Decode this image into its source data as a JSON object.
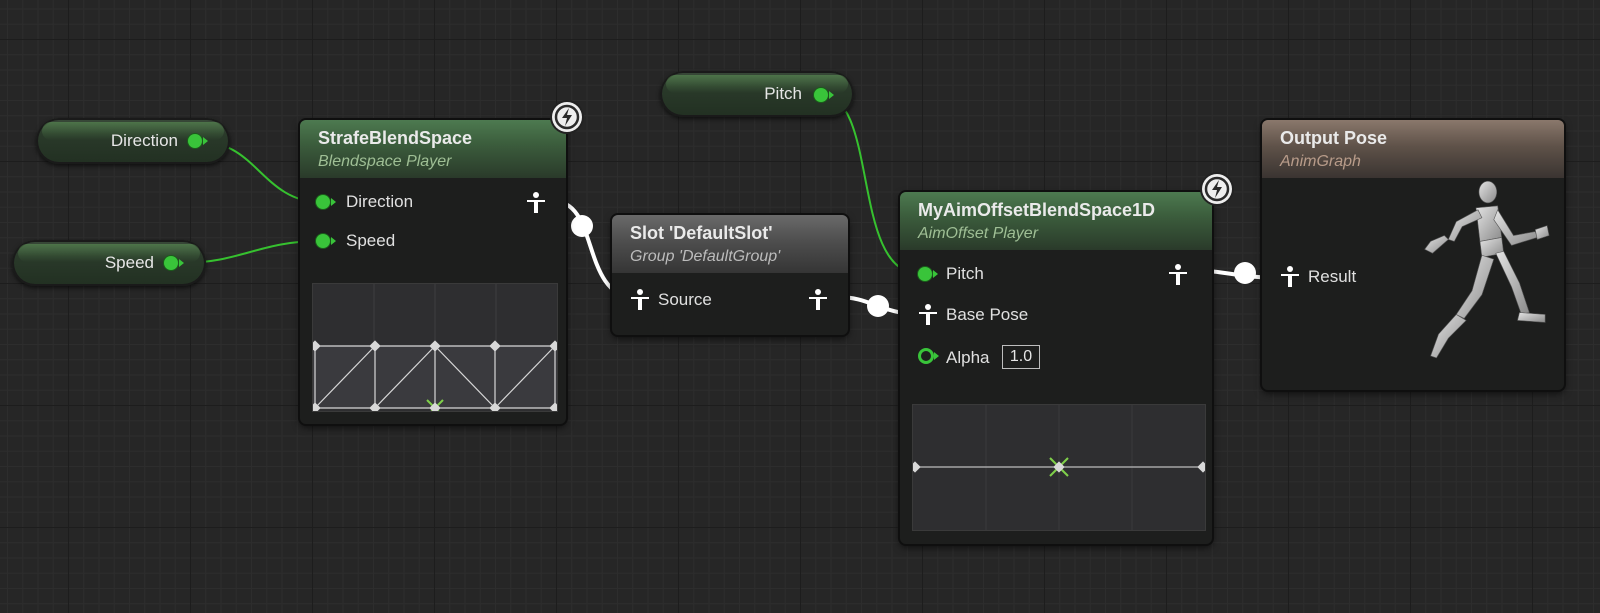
{
  "variables": {
    "direction": {
      "label": "Direction"
    },
    "speed": {
      "label": "Speed"
    },
    "pitch": {
      "label": "Pitch"
    }
  },
  "nodes": {
    "strafe_blend_space": {
      "title": "StrafeBlendSpace",
      "subtitle": "Blendspace Player",
      "pins": {
        "direction": "Direction",
        "speed": "Speed"
      }
    },
    "slot": {
      "title": "Slot 'DefaultSlot'",
      "subtitle": "Group 'DefaultGroup'",
      "pins": {
        "source": "Source"
      }
    },
    "aim_offset": {
      "title": "MyAimOffsetBlendSpace1D",
      "subtitle": "AimOffset Player",
      "pins": {
        "pitch": "Pitch",
        "base_pose": "Base Pose",
        "alpha": "Alpha",
        "alpha_value": "1.0"
      }
    },
    "output_pose": {
      "title": "Output Pose",
      "subtitle": "AnimGraph",
      "pins": {
        "result": "Result"
      }
    }
  },
  "colors": {
    "data_wire": "#36c12f",
    "exec_wire": "#ffffff",
    "canvas": "#262626"
  },
  "icons": [
    "lightning-bolt-icon",
    "pose-pin-icon",
    "mannequin-preview"
  ]
}
